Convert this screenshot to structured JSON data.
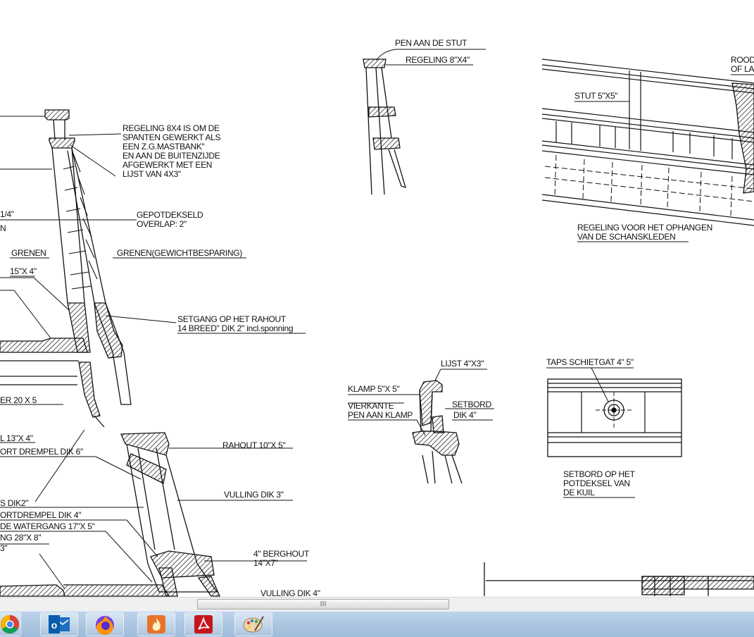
{
  "drawing": {
    "labels": {
      "regeling_mastbank_1": "REGELING  8X4  IS OM DE",
      "regeling_mastbank_2": "SPANTEN GEWERKT ALS",
      "regeling_mastbank_3": "EEN Z.G.MASTBANK\"",
      "regeling_mastbank_4": "EN AAN DE BUITENZIJDE",
      "regeling_mastbank_5": "AFGEWERKT MET EEN",
      "regeling_mastbank_6": "LIJST  VAN  4X3\"",
      "frag_quarter": "1/4\"",
      "frag_n": "N",
      "gepotdekseld_1": "GEPOTDEKSELD",
      "gepotdekseld_2": "OVERLAP: 2\"",
      "grenen": "GRENEN",
      "grenen_gewicht": "GRENEN(GEWICHTBESPARING)",
      "size_15x4": "15\"X 4\"",
      "setgang_1": "SETGANG OP HET RAHOUT",
      "setgang_2": "14 BREED\" DIK 2\"  incl.sponning",
      "frag_er20x5": "ER  20 X 5",
      "frag_l13x4": "L  13\"X 4\"",
      "frag_ort_drempel": "ORT DREMPEL  DIK 6\"",
      "rahout": "RAHOUT  10\"X 5\"",
      "vulling3": "VULLING  DIK 3\"",
      "frag_dik2": "S  DIK2\"",
      "frag_ortdrempel4": "ORTDREMPEL  DIK 4\"",
      "frag_watergang": "DE WATERGANG   17\"X 5\"",
      "frag_ng28x8": "NG  28\"X 8\"",
      "frag_3": "3\"",
      "berghout_1": "4\" BERGHOUT",
      "berghout_2": "14\"X7\"",
      "vulling4": "VULLING  DIK 4\"",
      "pen_stut": "PEN AAN DE STUT",
      "regeling_8x4": "REGELING  8\"X4\"",
      "stut": "STUT  5\"X5\"",
      "rood_1": "ROOD",
      "rood_2": "OF LA",
      "schanskleden_1": "REGELING VOOR HET OPHANGEN",
      "schanskleden_2": "VAN DE SCHANSKLEDEN",
      "lijst": "LIJST  4\"X3\"",
      "klamp": "KLAMP  5\"X 5\"",
      "vierkante_1": "VIERKANTE",
      "vierkante_2": "PEN AAN KLAMP",
      "setbord_1": "SETBORD",
      "setbord_2": "DIK  4\"",
      "taps": "TAPS  SCHIETGAT 4\" 5\"",
      "setbord_kuil_1": "SETBORD  OP HET",
      "setbord_kuil_2": "POTDEKSEL VAN",
      "setbord_kuil_3": "DE KUIL"
    }
  },
  "scrollbar": {
    "grip": "III"
  },
  "taskbar": {
    "apps": [
      {
        "name": "chrome-icon"
      },
      {
        "name": "outlook-icon",
        "glyph": "o"
      },
      {
        "name": "firefox-icon"
      },
      {
        "name": "fire-app-icon"
      },
      {
        "name": "acrobat-icon"
      },
      {
        "name": "paint-icon"
      }
    ]
  }
}
